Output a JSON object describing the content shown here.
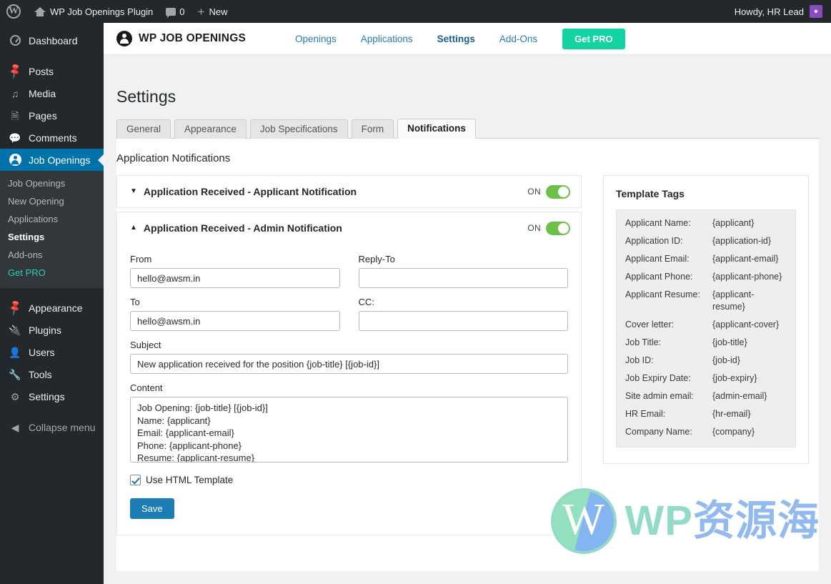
{
  "adminbar": {
    "wp_logo_icon": "wordpress-icon",
    "site_name": "WP Job Openings Plugin",
    "home_icon": "home-icon",
    "comments_icon": "comment-bubble-icon",
    "comments_count": "0",
    "new_icon": "plus-icon",
    "new_label": "New",
    "howdy": "Howdy, HR Lead",
    "avatar_icon": "user-avatar-icon"
  },
  "sidebar": {
    "items": [
      {
        "label": "Dashboard",
        "icon": "dashboard-icon"
      },
      {
        "label": "Posts",
        "icon": "pin-icon"
      },
      {
        "label": "Media",
        "icon": "media-icon"
      },
      {
        "label": "Pages",
        "icon": "pages-icon"
      },
      {
        "label": "Comments",
        "icon": "comments-icon"
      },
      {
        "label": "Job Openings",
        "icon": "job-openings-icon"
      }
    ],
    "submenu": [
      {
        "label": "Job Openings"
      },
      {
        "label": "New Opening"
      },
      {
        "label": "Applications"
      },
      {
        "label": "Settings"
      },
      {
        "label": "Add-ons"
      },
      {
        "label": "Get PRO"
      }
    ],
    "items_bottom": [
      {
        "label": "Appearance",
        "icon": "brush-icon"
      },
      {
        "label": "Plugins",
        "icon": "plug-icon"
      },
      {
        "label": "Users",
        "icon": "users-icon"
      },
      {
        "label": "Tools",
        "icon": "wrench-icon"
      },
      {
        "label": "Settings",
        "icon": "settings-icon"
      }
    ],
    "collapse": {
      "label": "Collapse menu",
      "icon": "collapse-arrow-icon"
    }
  },
  "plugin_header": {
    "brand": "WP JOB OPENINGS",
    "brand_icon": "wp-job-openings-logo-icon",
    "nav": [
      {
        "label": "Openings"
      },
      {
        "label": "Applications"
      },
      {
        "label": "Settings"
      },
      {
        "label": "Add-Ons"
      }
    ],
    "get_pro": "Get PRO"
  },
  "page": {
    "title": "Settings",
    "tabs": [
      {
        "label": "General"
      },
      {
        "label": "Appearance"
      },
      {
        "label": "Job Specifications"
      },
      {
        "label": "Form"
      },
      {
        "label": "Notifications"
      }
    ],
    "section_title": "Application Notifications"
  },
  "accordions": [
    {
      "title": "Application Received - Applicant Notification",
      "caret_icon": "chevron-down-icon",
      "toggle_label": "ON",
      "toggle_on": true
    },
    {
      "title": "Application Received - Admin Notification",
      "caret_icon": "chevron-up-icon",
      "toggle_label": "ON",
      "toggle_on": true
    }
  ],
  "form": {
    "from": {
      "label": "From",
      "value": "hello@awsm.in",
      "placeholder": ""
    },
    "reply_to": {
      "label": "Reply-To",
      "value": "",
      "placeholder": ""
    },
    "to": {
      "label": "To",
      "value": "hello@awsm.in",
      "placeholder": ""
    },
    "cc": {
      "label": "CC:",
      "value": "",
      "placeholder": ""
    },
    "subject": {
      "label": "Subject",
      "value": "New application received for the position {job-title} [{job-id}]",
      "placeholder": ""
    },
    "content": {
      "label": "Content",
      "value": "Job Opening: {job-title} [{job-id}]\nName: {applicant}\nEmail: {applicant-email}\nPhone: {applicant-phone}\nResume: {applicant-resume}",
      "placeholder": ""
    },
    "use_html_template": {
      "label": "Use HTML Template",
      "checked": true
    },
    "save_label": "Save"
  },
  "template_tags": {
    "title": "Template Tags",
    "rows": [
      {
        "key": "Applicant Name:",
        "value": "{applicant}"
      },
      {
        "key": "Application ID:",
        "value": "{application-id}"
      },
      {
        "key": "Applicant Email:",
        "value": "{applicant-email}"
      },
      {
        "key": "Applicant Phone:",
        "value": "{applicant-phone}"
      },
      {
        "key": "Applicant Resume:",
        "value": "{applicant-resume}"
      },
      {
        "key": "Cover letter:",
        "value": "{applicant-cover}"
      },
      {
        "key": "Job Title:",
        "value": "{job-title}"
      },
      {
        "key": "Job ID:",
        "value": "{job-id}"
      },
      {
        "key": "Job Expiry Date:",
        "value": "{job-expiry}"
      },
      {
        "key": "Site admin email:",
        "value": "{admin-email}"
      },
      {
        "key": "HR Email:",
        "value": "{hr-email}"
      },
      {
        "key": "Company Name:",
        "value": "{company}"
      }
    ]
  },
  "watermark": {
    "logo_icon": "wordpress-logo-icon",
    "text_en": "WP",
    "text_cn": "资源海"
  },
  "colors": {
    "admin_dark": "#23282d",
    "admin_submenu": "#32373c",
    "active_blue": "#0073aa",
    "toggle_green": "#6cc04a",
    "get_pro_green": "#13d3a3",
    "save_blue": "#1c7cb3",
    "link_blue": "#2a7ab0",
    "pro_teal": "#2ecfb2"
  }
}
